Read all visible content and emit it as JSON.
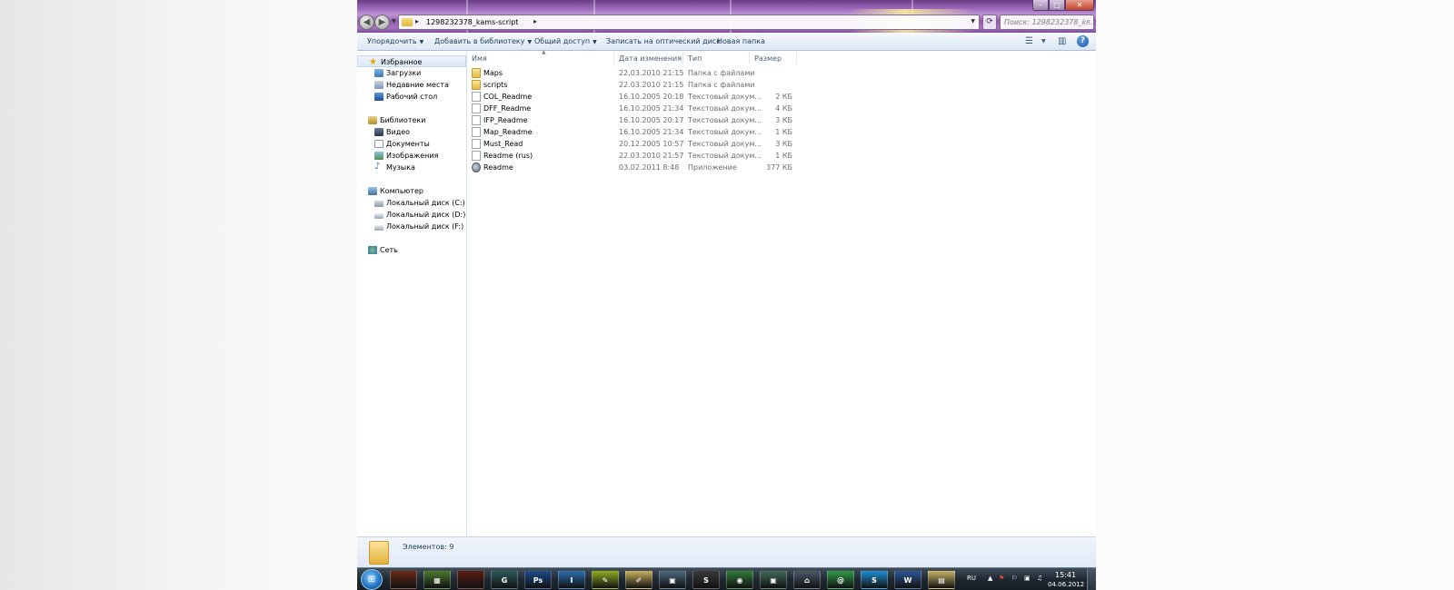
{
  "window": {
    "address": {
      "path": "1298232378_kams-script"
    },
    "search": {
      "placeholder": "Поиск: 1298232378_k..."
    },
    "controls": {
      "minimize": "–",
      "maximize": "□",
      "close": "✕"
    }
  },
  "toolbar": {
    "organize": "Упорядочить",
    "add_to_library": "Добавить в библиотеку",
    "share": "Общий доступ",
    "burn": "Записать на оптический диск",
    "new_folder": "Новая папка",
    "help": "?"
  },
  "navpane": {
    "favorites": {
      "label": "Избранное",
      "items": [
        "Загрузки",
        "Недавние места",
        "Рабочий стол"
      ]
    },
    "libraries": {
      "label": "Библиотеки",
      "items": [
        "Видео",
        "Документы",
        "Изображения",
        "Музыка"
      ]
    },
    "computer": {
      "label": "Компьютер",
      "items": [
        "Локальный диск (C:)",
        "Локальный диск (D:)",
        "Локальный диск (F:)"
      ]
    },
    "network": {
      "label": "Сеть"
    }
  },
  "columns": {
    "name": "Имя",
    "date": "Дата изменения",
    "type": "Тип",
    "size": "Размер"
  },
  "files": [
    {
      "name": "Maps",
      "date": "22.03.2010 21:15",
      "type": "Папка с файлами",
      "size": "",
      "icon": "folder-icon"
    },
    {
      "name": "scripts",
      "date": "22.03.2010 21:15",
      "type": "Папка с файлами",
      "size": "",
      "icon": "folder-icon"
    },
    {
      "name": "COL_Readme",
      "date": "16.10.2005 20:18",
      "type": "Текстовый докум...",
      "size": "2 КБ",
      "icon": "text-file-icon"
    },
    {
      "name": "DFF_Readme",
      "date": "16.10.2005 21:34",
      "type": "Текстовый докум...",
      "size": "4 КБ",
      "icon": "text-file-icon"
    },
    {
      "name": "IFP_Readme",
      "date": "16.10.2005 20:17",
      "type": "Текстовый докум...",
      "size": "3 КБ",
      "icon": "text-file-icon"
    },
    {
      "name": "Map_Readme",
      "date": "16.10.2005 21:34",
      "type": "Текстовый докум...",
      "size": "1 КБ",
      "icon": "text-file-icon"
    },
    {
      "name": "Must_Read",
      "date": "20.12.2005 10:57",
      "type": "Текстовый докум...",
      "size": "3 КБ",
      "icon": "text-file-icon"
    },
    {
      "name": "Readme (rus)",
      "date": "22.03.2010 21:57",
      "type": "Текстовый докум...",
      "size": "1 КБ",
      "icon": "text-file-icon"
    },
    {
      "name": "Readme",
      "date": "03.02.2011 8:48",
      "type": "Приложение",
      "size": "377 КБ",
      "icon": "application-icon"
    }
  ],
  "status": {
    "count_text": "Элементов: 9"
  },
  "taskbar": {
    "apps": [
      {
        "name": "game-app-1",
        "glyph": "",
        "color": "#6b2a1a"
      },
      {
        "name": "library-app",
        "glyph": "▦",
        "color": "#4a7a2e"
      },
      {
        "name": "game-app-2",
        "glyph": "",
        "color": "#5a1c12"
      },
      {
        "name": "3d-app",
        "glyph": "G",
        "color": "#2c5a5a"
      },
      {
        "name": "photoshop-app",
        "glyph": "Ps",
        "color": "#1b4a8a"
      },
      {
        "name": "dictionary-app",
        "glyph": "I",
        "color": "#2a6fb0"
      },
      {
        "name": "notes-app",
        "glyph": "✎",
        "color": "#8fae1e"
      },
      {
        "name": "paint-app",
        "glyph": "✐",
        "color": "#c8b060"
      },
      {
        "name": "window-app",
        "glyph": "▣",
        "color": "#4b6a80"
      },
      {
        "name": "steam-app",
        "glyph": "S",
        "color": "#3a3a3a"
      },
      {
        "name": "chrome-app",
        "glyph": "◉",
        "color": "#2f7d3a"
      },
      {
        "name": "window-app-2",
        "glyph": "▣",
        "color": "#3f6b5a"
      },
      {
        "name": "network-app",
        "glyph": "⌂",
        "color": "#4a5a6a"
      },
      {
        "name": "mail-agent-app",
        "glyph": "@",
        "color": "#2f9a48"
      },
      {
        "name": "skype-app",
        "glyph": "S",
        "color": "#1d8fd6"
      },
      {
        "name": "word-app",
        "glyph": "W",
        "color": "#2b5797"
      },
      {
        "name": "explorer-app",
        "glyph": "▤",
        "color": "#c9b36a"
      }
    ],
    "language": "RU",
    "time": "15:41",
    "date": "04.06.2012"
  }
}
